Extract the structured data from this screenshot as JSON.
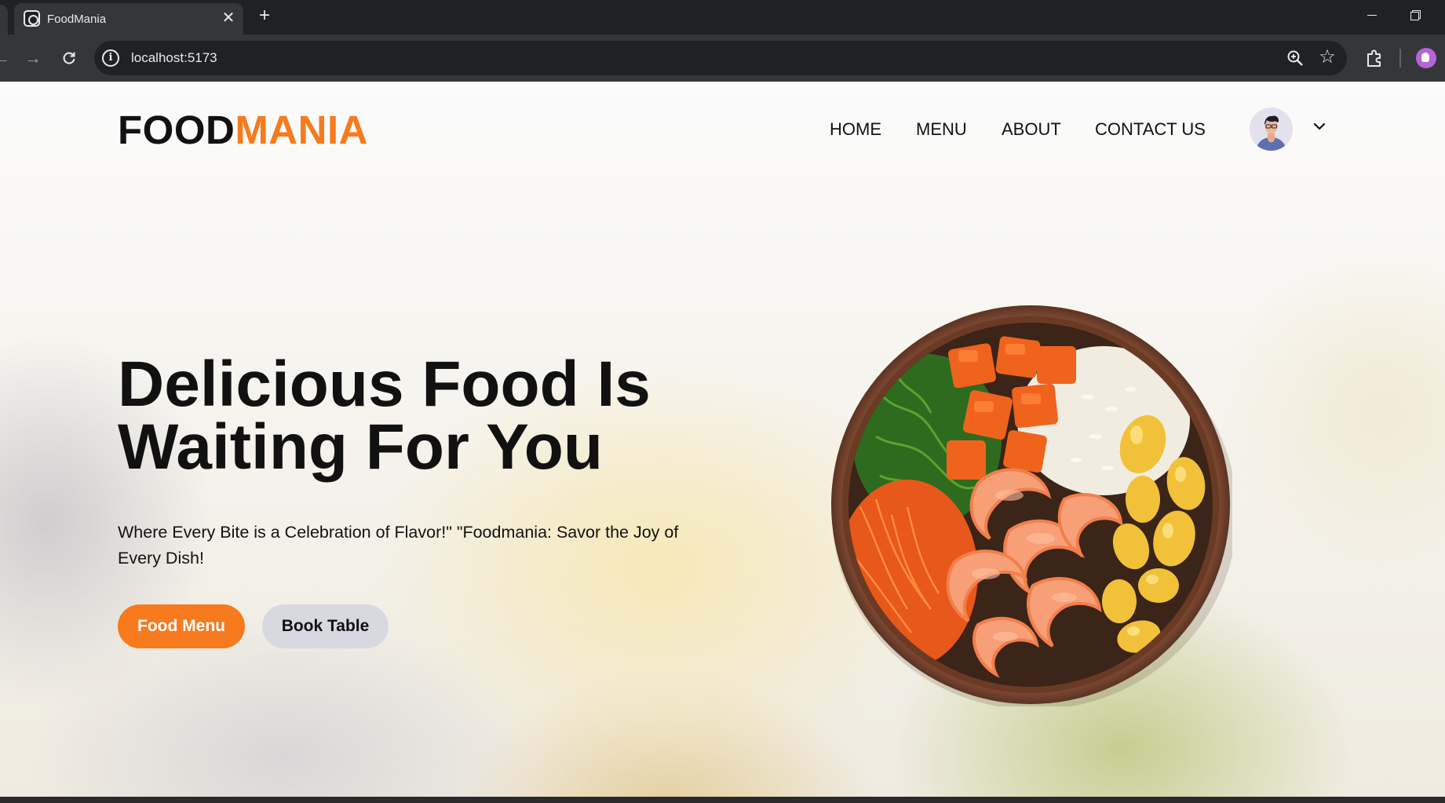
{
  "browser": {
    "tab_title": "FoodMania",
    "url": "localhost:5173",
    "icons": [
      "tab-favicon",
      "close-icon",
      "plus-icon",
      "back-icon",
      "forward-icon",
      "reload-icon",
      "info-icon",
      "zoom-icon",
      "star-icon",
      "extensions-icon",
      "profile-icon",
      "minimize-icon",
      "restore-icon"
    ]
  },
  "header": {
    "logo_part1": "FOOD",
    "logo_part2": "MANIA",
    "nav": [
      "HOME",
      "MENU",
      "ABOUT",
      "CONTACT US"
    ]
  },
  "hero": {
    "title": "Delicious Food Is Waiting For You",
    "subtitle": "Where Every Bite is a Celebration of Flavor!\" \"Foodmania: Savor the Joy of Every Dish!",
    "primary_button": "Food Menu",
    "secondary_button": "Book Table"
  },
  "colors": {
    "accent": "#f77a1e",
    "secondary_button_bg": "#d8d9e0",
    "text": "#111111"
  }
}
